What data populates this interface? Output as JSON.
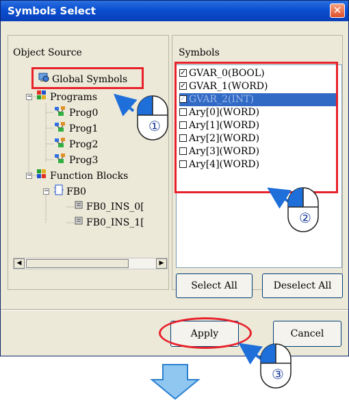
{
  "dialog": {
    "title": "Symbols Select",
    "close_glyph": "✕"
  },
  "object_source": {
    "label": "Object Source",
    "items": [
      {
        "label": "Global Symbols",
        "icon": "global-symbols-icon"
      },
      {
        "label": "Programs",
        "icon": "programs-folder-icon"
      },
      {
        "label": "Prog0",
        "icon": "program-icon"
      },
      {
        "label": "Prog1",
        "icon": "program-icon"
      },
      {
        "label": "Prog2",
        "icon": "program-icon"
      },
      {
        "label": "Prog3",
        "icon": "program-icon"
      },
      {
        "label": "Function Blocks",
        "icon": "function-blocks-folder-icon"
      },
      {
        "label": "FB0",
        "icon": "function-block-icon"
      },
      {
        "label": "FB0_INS_0[",
        "icon": "fb-instance-icon"
      },
      {
        "label": "FB0_INS_1[",
        "icon": "fb-instance-icon"
      }
    ]
  },
  "symbols": {
    "label": "Symbols",
    "items": [
      {
        "label": "GVAR_0(BOOL)",
        "checked": true,
        "selected": false
      },
      {
        "label": "GVAR_1(WORD)",
        "checked": true,
        "selected": false
      },
      {
        "label": "GVAR_2(INT)",
        "checked": true,
        "selected": true
      },
      {
        "label": "Ary[0](WORD)",
        "checked": false,
        "selected": false
      },
      {
        "label": "Ary[1](WORD)",
        "checked": false,
        "selected": false
      },
      {
        "label": "Ary[2](WORD)",
        "checked": false,
        "selected": false
      },
      {
        "label": "Ary[3](WORD)",
        "checked": false,
        "selected": false
      },
      {
        "label": "Ary[4](WORD)",
        "checked": false,
        "selected": false
      }
    ]
  },
  "buttons": {
    "select_all": "Select All",
    "deselect_all": "Deselect All",
    "apply": "Apply",
    "cancel": "Cancel"
  },
  "callouts": {
    "step1": "①",
    "step2": "②",
    "step3": "③"
  },
  "colors": {
    "highlight_red": "#e8202a",
    "arrow_blue": "#1e6fd9",
    "selection_blue": "#316ac5"
  }
}
